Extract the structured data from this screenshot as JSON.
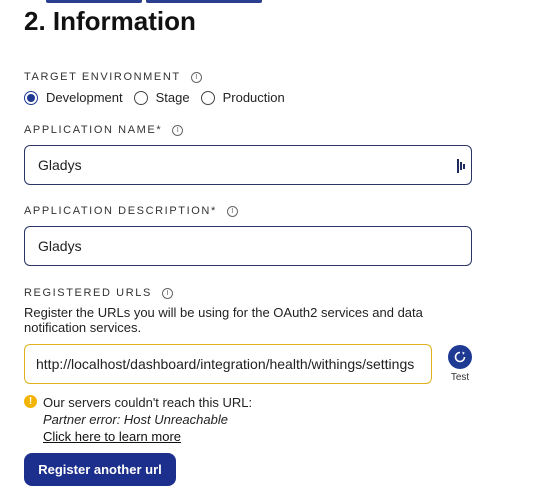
{
  "section": {
    "title": "2. Information"
  },
  "target_environment": {
    "label": "TARGET ENVIRONMENT",
    "options": [
      {
        "label": "Development",
        "checked": true
      },
      {
        "label": "Stage",
        "checked": false
      },
      {
        "label": "Production",
        "checked": false
      }
    ]
  },
  "application_name": {
    "label": "APPLICATION NAME*",
    "value": "Gladys"
  },
  "application_description": {
    "label": "APPLICATION DESCRIPTION*",
    "value": "Gladys"
  },
  "registered_urls": {
    "label": "REGISTERED URLS",
    "help": "Register the URLs you will be using for the OAuth2 services and data notification services.",
    "url_value": "http://localhost/dashboard/integration/health/withings/settings",
    "test_label": "Test"
  },
  "error": {
    "message": "Our servers couldn't reach this URL:",
    "detail": "Partner error: Host Unreachable",
    "link": "Click here to learn more"
  },
  "actions": {
    "register_another_label": "Register another url"
  },
  "colors": {
    "primary": "#1c2f8c",
    "warning": "#f2b400",
    "field_border": "#2a3565"
  }
}
